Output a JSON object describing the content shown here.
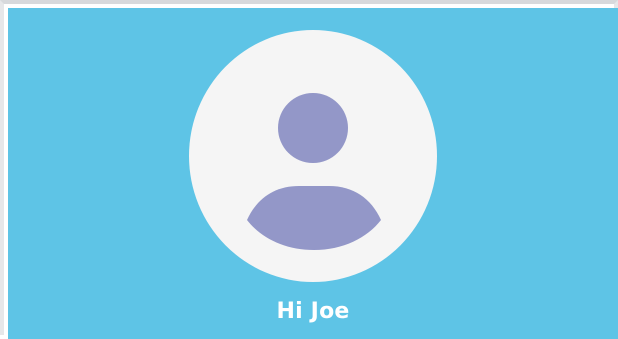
{
  "greeting": {
    "text": "Hi Joe"
  },
  "avatar": {
    "icon": "user-avatar-icon"
  },
  "colors": {
    "background": "#5ec4e6",
    "avatar_circle": "#f5f5f5",
    "avatar_figure": "#9397c8",
    "text": "#ffffff"
  }
}
